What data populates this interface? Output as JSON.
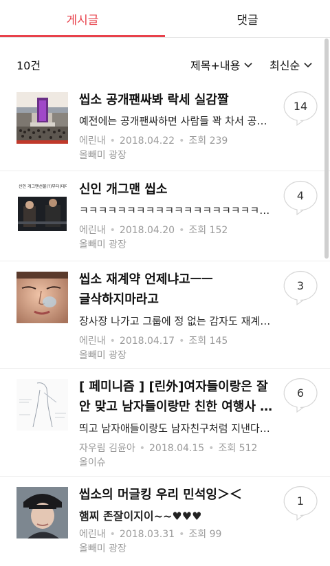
{
  "tabs": [
    {
      "label": "게시글",
      "active": true
    },
    {
      "label": "댓글",
      "active": false
    }
  ],
  "toolbar": {
    "count": "10건",
    "filter": "제목+내용",
    "sort": "최신순"
  },
  "colors": {
    "accent": "#e8414b"
  },
  "posts": [
    {
      "title_line1": "씹소 공개팬싸봐 락세 실감짤",
      "title_line2": "",
      "snippet": "예전에는 공개팬싸하면 사람들 꽉 차서 공연장도 엄청났는데",
      "author": "에린내",
      "date": "2018.04.22",
      "views_label": "조회",
      "views": "239",
      "board": "올빼미 광장",
      "comments": "14",
      "thumb": "mall-crowd"
    },
    {
      "title_line1": "신인 개그맨 씹소",
      "title_line2": "",
      "snippet": "ㅋㅋㅋㅋㅋㅋㅋㅋㅋㅋㅋㅋㅋㅋㅋㅋㅋㅋㅋㅋㅋㅋㅋㅋ",
      "author": "에린내",
      "date": "2018.04.20",
      "views_label": "조회",
      "views": "152",
      "board": "올빼미 광장",
      "comments": "4",
      "thumb": "tv-capture",
      "thumb_caption": "신인 개그맨선물(?)부터(데이엔트)"
    },
    {
      "title_line1": "씹소 재계약 언제냐고ㅡㅡ",
      "title_line2": "글삭하지마라고",
      "snippet": "장사장 나가고 그룹에 정 없는 감자도 재계약 확정인데",
      "author": "에린내",
      "date": "2018.04.17",
      "views_label": "조회",
      "views": "145",
      "board": "올빼미 광장",
      "comments": "3",
      "thumb": "face-closeup"
    },
    {
      "title_line1": "[ 페미니즘 ] [린外]여자들이랑은 잘",
      "title_line2": "안 맞고 남자들이랑만 친한 여행사 직원",
      "snippet": "띄고 남자애들이랑도 남자친구처럼 지낸다는데",
      "author": "자우림 김윤아",
      "date": "2018.04.15",
      "views_label": "조회",
      "views": "512",
      "board": "올이슈",
      "comments": "6",
      "thumb": "sketch"
    },
    {
      "title_line1": "씹소의 머글킹 우리 민석잉＞＜",
      "title_line2": "",
      "snippet": "햄찌 존잘이지이~~♥♥♥",
      "author": "에린내",
      "date": "2018.03.31",
      "views_label": "조회",
      "views": "99",
      "board": "올빼미 광장",
      "comments": "1",
      "thumb": "cap-portrait"
    }
  ]
}
